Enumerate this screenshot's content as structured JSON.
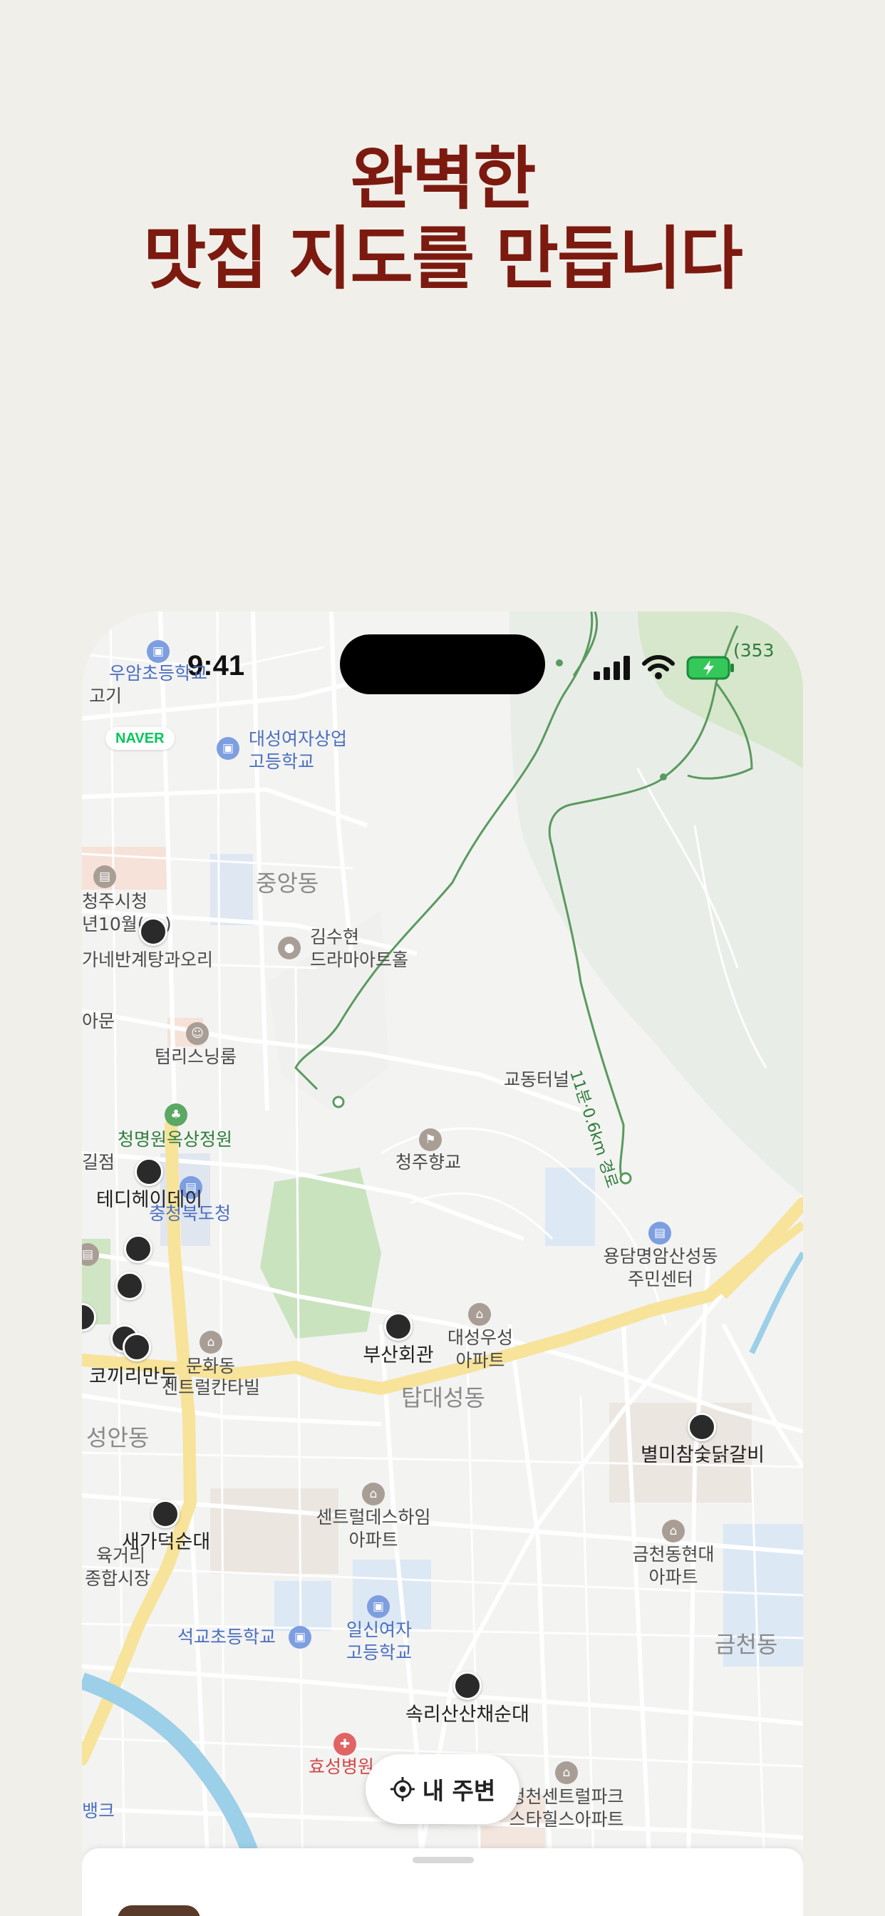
{
  "headline": {
    "line1": "완벽한",
    "line2": "맛집 지도를 만듭니다"
  },
  "status_bar": {
    "time": "9:41"
  },
  "map": {
    "provider_badge": "NAVER",
    "elevation_label": "(353",
    "trail_label": "11분·0.6km 경로",
    "districts": [
      "중앙동",
      "탑대성동",
      "성안동",
      "금천동"
    ],
    "places": [
      "우암초등학교",
      "고기",
      "대성여자상업",
      "고등학교",
      "청주시청",
      "년10월(",
      ")",
      "김수현",
      "드라마아트홀",
      "가네반계탕과오리",
      "아문",
      "텀리스닝룸",
      "교동터널",
      "청명원옥상정원",
      "청주향교",
      "길점",
      "충청북도청",
      "용담명암산성동",
      "주민센터",
      "대성우성",
      "아파트",
      "문화동",
      "센트럴칸타빌",
      "센트럴데스하임",
      "아파트",
      "금천동현대",
      "아파트",
      "육거리",
      "종합시장",
      "석교초등학교",
      "일신여자",
      "고등학교",
      "효성병원",
      "청천센트럴파크",
      "스타힐스아파트",
      "뱅크"
    ],
    "restaurants": [
      "테디헤이데이",
      "부산회관",
      "코끼리만두",
      "별미참숯닭갈비",
      "새가덕순대",
      "속리산산채순대"
    ],
    "nearby_button": "내 주변"
  }
}
